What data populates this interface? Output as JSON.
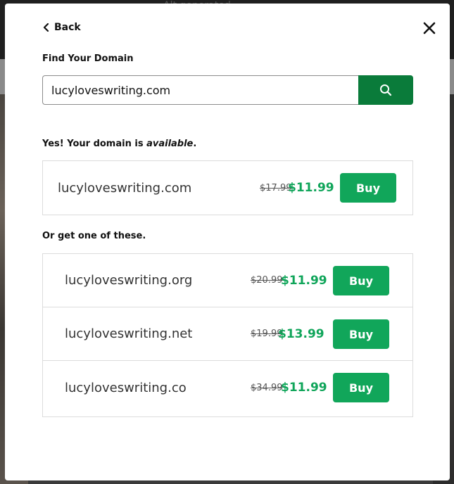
{
  "background": {
    "top_text": "Alt generated"
  },
  "modal": {
    "back_label": "Back",
    "find_label": "Find Your Domain",
    "search_value": "lucyloveswriting.com",
    "available_prefix": "Yes! Your domain is ",
    "available_word": "available",
    "available_suffix": ".",
    "primary": {
      "domain": "lucyloveswriting.com",
      "old_price": "$17.99",
      "new_price": "$11.99",
      "buy_label": "Buy"
    },
    "alternatives_label": "Or get one of these.",
    "alternatives": [
      {
        "domain": "lucyloveswriting.org",
        "old_price": "$20.99",
        "new_price": "$11.99",
        "buy_label": "Buy"
      },
      {
        "domain": "lucyloveswriting.net",
        "old_price": "$19.99",
        "new_price": "$13.99",
        "buy_label": "Buy"
      },
      {
        "domain": "lucyloveswriting.co",
        "old_price": "$34.99",
        "new_price": "$11.99",
        "buy_label": "Buy"
      }
    ]
  },
  "colors": {
    "accent": "#11a65a",
    "search_button": "#0a7b3a",
    "price": "#10a55a"
  },
  "icons": {
    "back": "chevron-left-icon",
    "close": "close-icon",
    "search": "search-icon"
  }
}
